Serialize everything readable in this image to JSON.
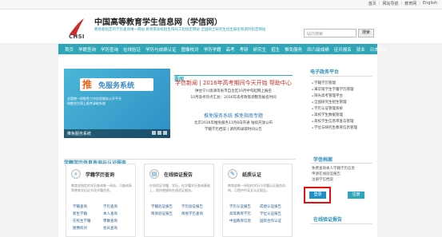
{
  "top_links": [
    "首页",
    "网站导航",
    "教育网",
    "English"
  ],
  "header": {
    "logo_text": "CHSI",
    "title": "中国高等教育学生信息网（学信网）",
    "subtitle": "教育部指定的学历查询唯一网站   教育部高校招生阳光工程指定网站   全国硕士研究生招生报名和调剂指定网站",
    "search_placeholder": "站内搜索",
    "search_button": "搜索"
  },
  "nav": [
    "首页",
    "学籍查询",
    "学历查询",
    "在线验证",
    "学历与成绩认证",
    "图像校对",
    "学历学籍",
    "高考",
    "考研",
    "研究生",
    "招生",
    "推免服务",
    "四六级成绩",
    "征兵报名",
    "就业",
    "日本频道"
  ],
  "banner": {
    "title_a": "推",
    "title_b": "免服务系统",
    "lines": [
      "全国统一的推免工作信息服务公开平台",
      "和推免生网上报考录取系统"
    ],
    "caption": "推免服务系统"
  },
  "news": {
    "header": "要闻",
    "headline": "学信新闻 | 2016年高考期间今天开始  帮助中心",
    "items_1": [
      "陕甘宁川渝滇等省市自治区10月中旬起网上报名",
      "10月高考热点汇总：2016年高考政策调整及报名时间"
    ],
    "headline2": "推免服务系统  推免指南专题",
    "items_2": [
      "北京2016年推免服务11月8日开通  陆续开放公布",
      "学籍学历档案  |  调剂和录取时间公告"
    ]
  },
  "right_col": {
    "platform_title": "电子政务平台",
    "platform_items": [
      "学籍学历管理",
      "来华留学生学籍学历管理",
      "阳光高考管理平台",
      "全国研究生招生管理",
      "学历认证管理系统",
      "高校学生数据管理",
      "高校学生信息审查与管理",
      "学位与研究生教育信息管理"
    ],
    "archive_title": "学信档案",
    "archive_lines": [
      "免费查询本人学籍学历信息",
      "申请在线验证报告",
      "注册学信档案"
    ],
    "login": "登录",
    "register": "注册",
    "verify_title": "在线验证报告"
  },
  "lower": {
    "section_title": "学籍学历信息查询与认证服务",
    "col1": {
      "title": "学籍学历查询",
      "desc": "教育部指定的学历查询唯一网站，可查询高等教育学历证书及学籍信息。",
      "links": [
        "学籍查询",
        "学历查询",
        "新生学籍",
        "本人查询",
        "在校生学籍",
        "零散查询",
        "图像校对",
        "会员查询"
      ]
    },
    "col2": {
      "title": "在线验证报告",
      "desc": "在线验证学籍、学历，在学籍学历查询基础上，提供便捷的在线验证服务。",
      "links": [
        "学籍验证报告",
        "学历验证报告",
        "简易验证报告",
        "简易学历查询"
      ]
    },
    "col3": {
      "title": "纸质认证",
      "desc": "教育部唯一授权的学历与学籍认证服务机构，可提供中英文认证报告。",
      "links": [
        "学历认证报告",
        "成绩认证报告",
        "高等教育学历",
        "学位认证报告",
        "中国教育信息",
        "国际合作认证"
      ]
    }
  }
}
